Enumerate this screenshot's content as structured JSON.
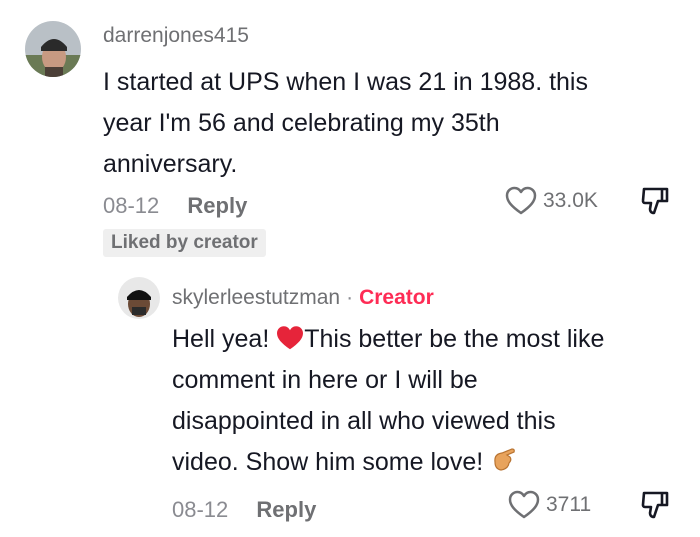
{
  "comment": {
    "username": "darrenjones415",
    "text_lines": [
      "I started at UPS when I was 21 in 1988. this",
      "year I'm 56 and celebrating my 35th",
      "anniversary."
    ],
    "date": "08-12",
    "reply_label": "Reply",
    "likes": "33.0K",
    "liked_by_creator": "Liked by creator",
    "icons": {
      "avatar": "avatar-icon",
      "like": "heart-outline-icon",
      "dislike": "thumbs-down-icon"
    }
  },
  "reply": {
    "username": "skylerleestutzman",
    "creator_label": "Creator",
    "text_line1_a": "Hell yea! ",
    "text_line1_b": "This better be the most like",
    "text_lines_rest": [
      "comment in here or I will be",
      "disappointed in all who viewed this"
    ],
    "text_last": "video. Show him some love! ",
    "date": "08-12",
    "reply_label": "Reply",
    "likes": "3711",
    "icons": {
      "heart_emoji": "red-heart-emoji-icon",
      "hand_emoji": "pointing-hand-emoji-icon"
    }
  },
  "colors": {
    "creator": "#fe2c55",
    "text": "#161823",
    "muted": "#8a8b91"
  }
}
